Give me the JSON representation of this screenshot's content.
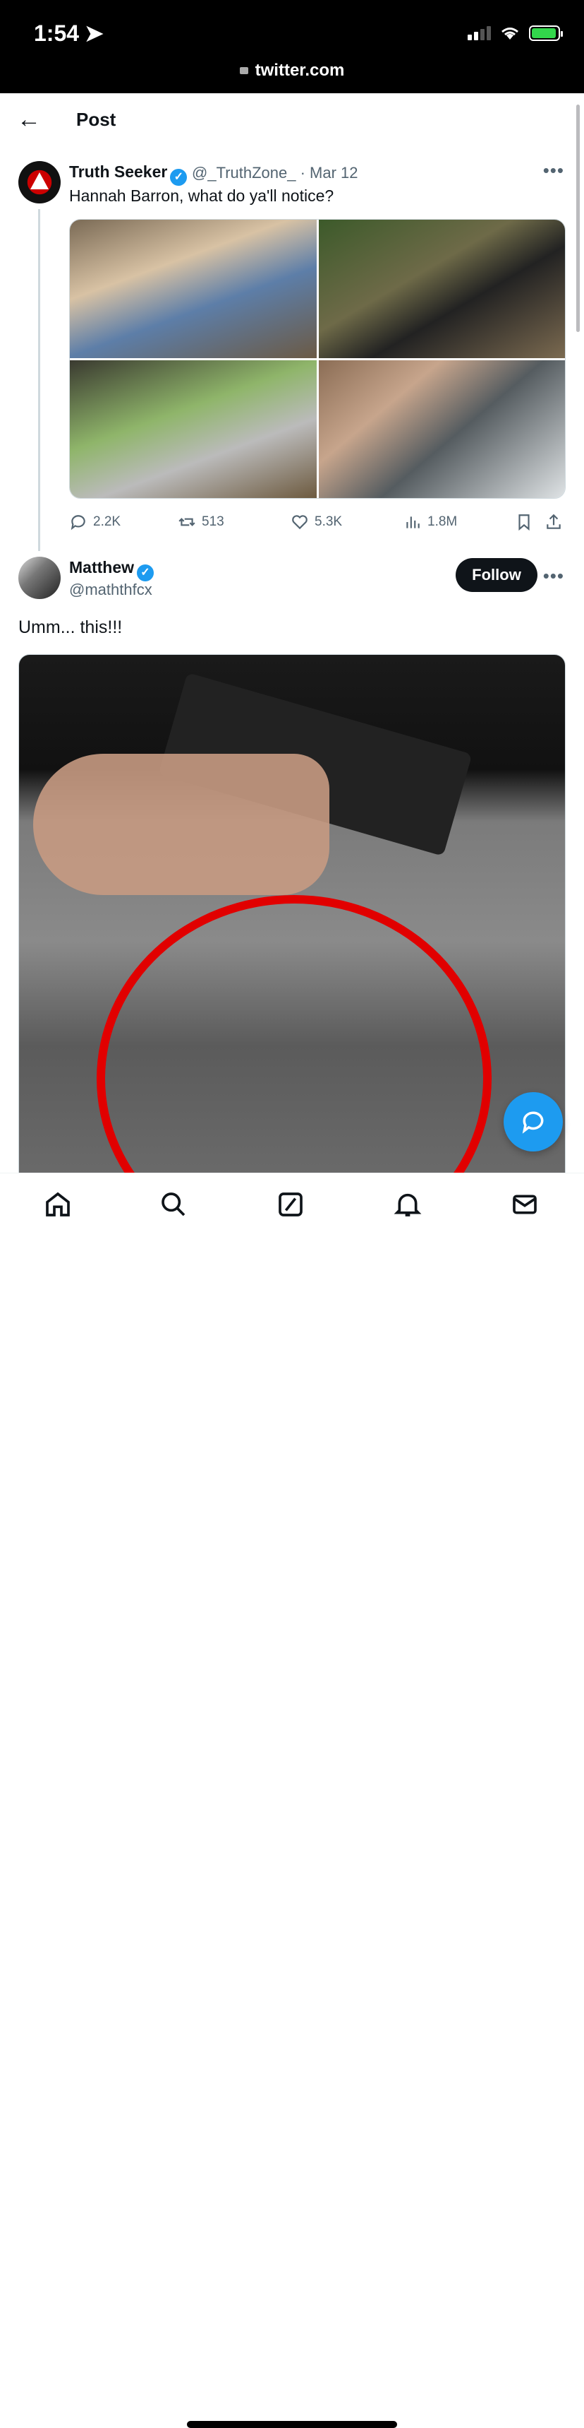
{
  "status_bar": {
    "time": "1:54",
    "url": "twitter.com"
  },
  "header": {
    "title": "Post"
  },
  "tweet1": {
    "name": "Truth Seeker",
    "handle": "@_TruthZone_",
    "date": "· Mar 12",
    "text": "Hannah Barron, what do ya'll notice?",
    "replies": "2.2K",
    "retweets": "513",
    "likes": "5.3K",
    "views": "1.8M"
  },
  "tweet2": {
    "name": "Matthew",
    "handle": "@maththfcx",
    "follow_label": "Follow",
    "text": "Umm... this!!!"
  },
  "colors": {
    "accent": "#1d9bf0",
    "text": "#0f1419",
    "secondary": "#536471"
  },
  "icons": {
    "tabs": [
      "home-icon",
      "search-icon",
      "grok-icon",
      "notifications-icon",
      "messages-icon"
    ],
    "actions": [
      "reply-icon",
      "retweet-icon",
      "like-icon",
      "views-icon",
      "bookmark-icon",
      "share-icon"
    ]
  }
}
